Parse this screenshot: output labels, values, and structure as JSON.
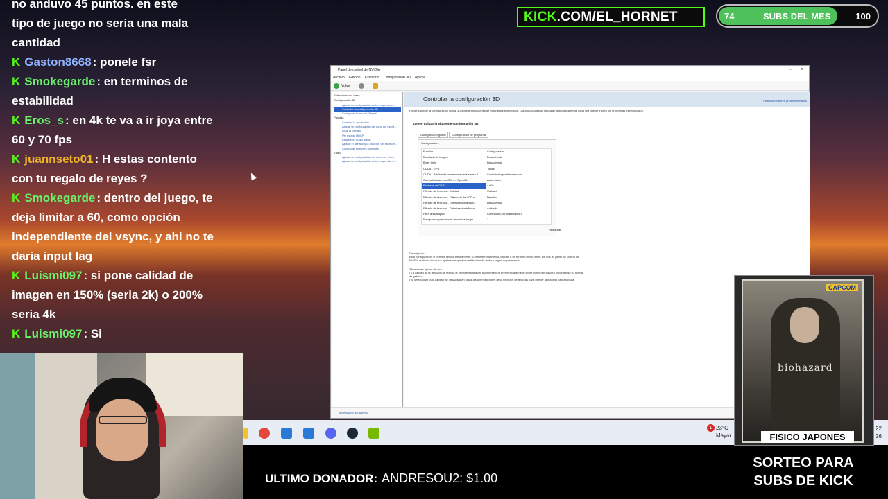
{
  "chat": [
    {
      "user": "",
      "text": "no anduvo 45 puntos. en este"
    },
    {
      "user": "",
      "text": "tipo de juego no seria una mala"
    },
    {
      "user": "",
      "text": "cantidad"
    },
    {
      "user": "Gaston8668",
      "color": "#8fb2ff",
      "text": ": ponele fsr"
    },
    {
      "user": "Smokegarde",
      "color": "#6bf06b",
      "text": ": en terminos de estabilidad"
    },
    {
      "user": "Eros_s",
      "color": "#6bf06b",
      "text": ": en 4k te va a ir joya entre 60 y 70 fps"
    },
    {
      "user": "juannseto01",
      "color": "#f0b429",
      "text": ": H estas contento con tu regalo de reyes ?"
    },
    {
      "user": "Smokegarde",
      "color": "#6bf06b",
      "text": ": dentro del juego, te deja limitar a 60, como opción independiente del vsync, y ahi no te daria input lag"
    },
    {
      "user": "Luismi097",
      "color": "#6bf06b",
      "text": ": si pone calidad de imagen en 150% (seria 2k) o 200% seria 4k"
    },
    {
      "user": "Luismi097",
      "color": "#6bf06b",
      "text": ": Si"
    }
  ],
  "kick_badge": "K",
  "kick_channel": {
    "prefix": "KICK",
    "rest": ".COM/EL_HORNET"
  },
  "subs_goal": {
    "current": "74",
    "label": "SUBS DEL MES",
    "goal": "100",
    "progress": 0.74
  },
  "window": {
    "title": "Panel de control de NVIDIA",
    "menu": [
      "Archivo",
      "Edición",
      "Escritorio",
      "Configuración 3D",
      "Ayuda"
    ],
    "back_label": "Volver",
    "tree_header": "Seleccione una tarea...",
    "tree": [
      {
        "label": "Configuración 3D",
        "type": "cat"
      },
      {
        "label": "Ajustar la configuración de la imagen con...",
        "type": "item"
      },
      {
        "label": "Controlar la configuración 3D",
        "type": "sel"
      },
      {
        "label": "Configurar Surround, PhysX",
        "type": "item"
      },
      {
        "label": "Pantalla",
        "type": "cat"
      },
      {
        "label": "Cambiar la resolución",
        "type": "item"
      },
      {
        "label": "Ajustar la configuración del color del escrit...",
        "type": "item"
      },
      {
        "label": "Girar la pantalla",
        "type": "item"
      },
      {
        "label": "Ver estado HDCP",
        "type": "item"
      },
      {
        "label": "Establecer audio digital",
        "type": "item"
      },
      {
        "label": "Ajustar el tamaño y la posición del escritori...",
        "type": "item"
      },
      {
        "label": "Configurar múltiples pantallas",
        "type": "item"
      },
      {
        "label": "Vídeo",
        "type": "cat"
      },
      {
        "label": "Ajustar la configuración del color del vídeo",
        "type": "item"
      },
      {
        "label": "Ajustar la configuración de la imagen de ví...",
        "type": "item"
      }
    ],
    "heading": "Controlar la configuración 3D",
    "restore_defaults": "Restaurar valores predeterminados",
    "description": "Puede cambiar la configuración global 3D y crear anulaciones de programas específicos. Las anulaciones se utilizarán automáticamente cada vez que se inicien los programas especificados.",
    "question": "Deseo utilizar la siguiente configuración 3D:",
    "tabs": [
      "Configuración global",
      "Configuración de programa"
    ],
    "config_label": "Configuración:",
    "rows": [
      {
        "f": "Función",
        "v": "Configuración"
      },
      {
        "f": "Escala de la imagen",
        "v": "Desactivada"
      },
      {
        "f": "Búfer triple",
        "v": "Desactivado"
      },
      {
        "f": "CUDA - GPU",
        "v": "Todas"
      },
      {
        "f": "CUDA - Política de la memoria del sistema d...",
        "v": "Controlador predeterminado"
      },
      {
        "f": "Compatibilidad con GDI en OpenGL",
        "v": "Automático"
      },
      {
        "f": "Factores de DSR",
        "v": "4.00x"
      },
      {
        "f": "Filtrado de texturas - Calidad",
        "v": "Calidad"
      },
      {
        "f": "Filtrado de texturas - Diferencia de LOD n...",
        "v": "Permitir"
      },
      {
        "f": "Filtrado de texturas - Optimización anisot...",
        "v": "Desactivado"
      },
      {
        "f": "Filtrado de texturas - Optimización trilineal",
        "v": "Activado"
      },
      {
        "f": "Filtro anisotrópico",
        "v": "Controlado por la aplicación"
      },
      {
        "f": "Fotogramas precalentar renderizados po...",
        "v": "1"
      }
    ],
    "selected_row": 6,
    "restaurar": "Restaurar",
    "desc_title": "Descripción:",
    "desc_text": "Esta configuración le permite decidir ampliamente si prefiere rendimiento, calidad o un término medio entre los dos. El panel de control de NVIDIA realizará todos los ajustes apropiados de filtración de textura según su preferencia.",
    "usage_title": "Situaciones típicas de uso:",
    "usage_1": "• La calidad de la filtración de textura le permite establecer fácilmente una preferencia general sobre cómo reproducirá el contenido su tarjeta de gráficos",
    "usage_2": "• Al seleccionar 'Alta calidad' se desactivarán todas las optimizaciones de la filtración de texturas para ofrecer la máxima calidad visual",
    "status_link": "Información del sistema"
  },
  "taskbar": {
    "temp": "23°C",
    "weather": "Mayor...",
    "notif": "1",
    "clock_top": "22",
    "clock_bottom": "26"
  },
  "donor": {
    "label": "ULTIMO DONADOR:",
    "value": "ANDRESOU2: $1.00"
  },
  "giveaway": {
    "capcom": "CAPCOM",
    "game": "biohazard",
    "tag": "FISICO JAPONES",
    "line1": "SORTEO PARA",
    "line2": "SUBS DE KICK"
  }
}
